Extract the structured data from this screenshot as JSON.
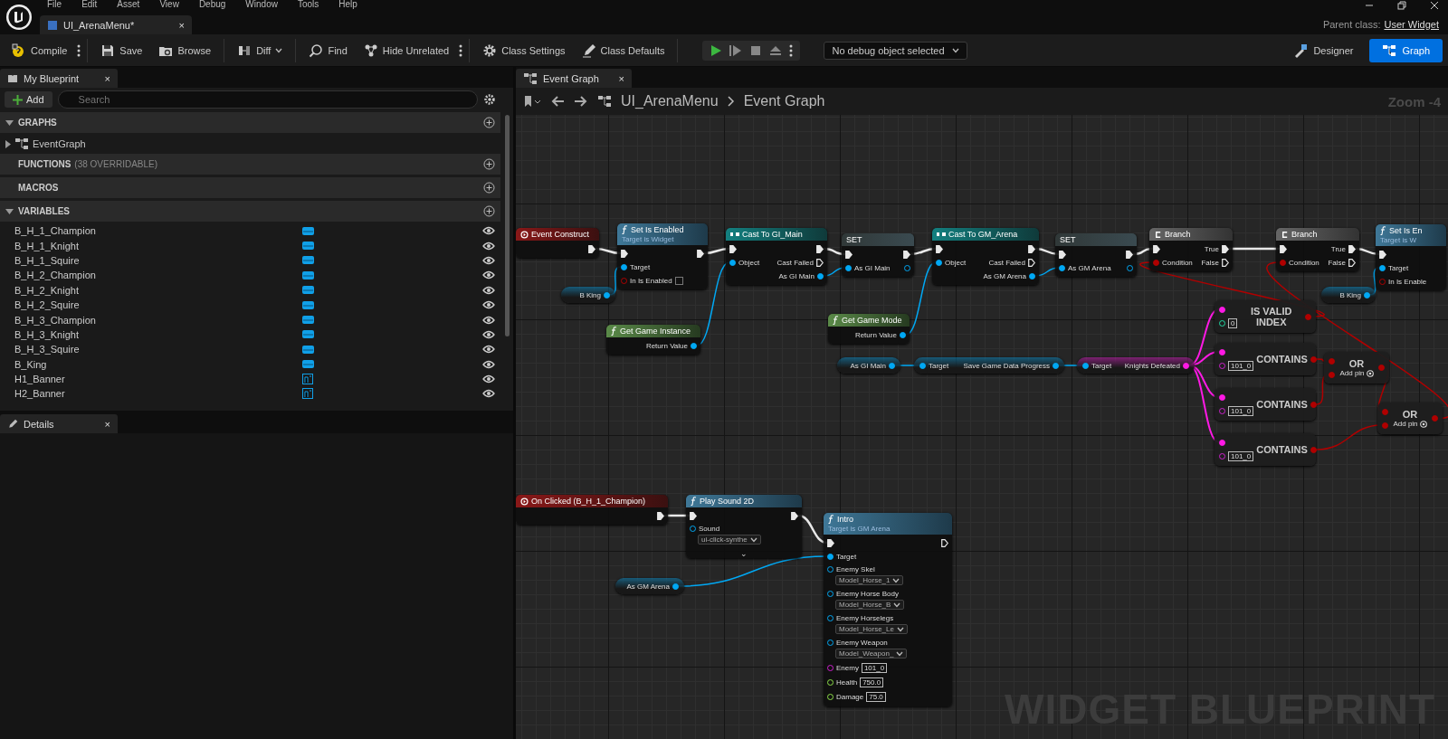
{
  "menu_bar": [
    "File",
    "Edit",
    "Asset",
    "View",
    "Debug",
    "Window",
    "Tools",
    "Help"
  ],
  "document_tab": {
    "title": "UI_ArenaMenu*",
    "close": "×"
  },
  "parent_class": {
    "label": "Parent class:",
    "value": "User Widget"
  },
  "toolbar": {
    "buttons": [
      {
        "kind": "compile",
        "label": "Compile",
        "menu": true
      },
      {
        "kind": "save",
        "label": "Save",
        "menu": false
      },
      {
        "kind": "browse",
        "label": "Browse",
        "menu": false
      },
      {
        "kind": "diff",
        "label": "Diff",
        "menu": false
      },
      {
        "kind": "find",
        "label": "Find",
        "menu": false
      },
      {
        "kind": "hide",
        "label": "Hide Unrelated",
        "menu": true
      },
      {
        "kind": "settings",
        "label": "Class Settings",
        "menu": false
      },
      {
        "kind": "defaults",
        "label": "Class Defaults",
        "menu": false
      }
    ],
    "debug_select": "No debug object selected",
    "modes": [
      {
        "kind": "designer",
        "label": "Designer",
        "selected": false
      },
      {
        "kind": "graph",
        "label": "Graph",
        "selected": true
      }
    ]
  },
  "my_blueprint": {
    "title": "My Blueprint",
    "close": "×",
    "add": "Add",
    "search_placeholder": "Search",
    "sections": [
      {
        "title": "GRAPHS",
        "expanded": true,
        "items": [
          {
            "label": "EventGraph"
          }
        ]
      },
      {
        "title": "FUNCTIONS",
        "note": "(38 OVERRIDABLE)",
        "expanded": false
      },
      {
        "title": "MACROS",
        "expanded": false
      },
      {
        "title": "VARIABLES",
        "expanded": true
      }
    ],
    "variables": [
      {
        "name": "B_H_1_Champion",
        "kind": "button"
      },
      {
        "name": "B_H_1_Knight",
        "kind": "button"
      },
      {
        "name": "B_H_1_Squire",
        "kind": "button"
      },
      {
        "name": "B_H_2_Champion",
        "kind": "button"
      },
      {
        "name": "B_H_2_Knight",
        "kind": "button"
      },
      {
        "name": "B_H_2_Squire",
        "kind": "button"
      },
      {
        "name": "B_H_3_Champion",
        "kind": "button"
      },
      {
        "name": "B_H_3_Knight",
        "kind": "button"
      },
      {
        "name": "B_H_3_Squire",
        "kind": "button"
      },
      {
        "name": "B_King",
        "kind": "button"
      },
      {
        "name": "H1_Banner",
        "kind": "image"
      },
      {
        "name": "H2_Banner",
        "kind": "image"
      }
    ]
  },
  "details": {
    "title": "Details",
    "close": "×"
  },
  "graph_tab": {
    "title": "Event Graph",
    "close": "×"
  },
  "breadcrumb": [
    "UI_ArenaMenu",
    "Event Graph"
  ],
  "zoom_label": "Zoom -4",
  "graph_watermark": "WIDGET BLUEPRINT",
  "nodes": [
    {
      "kind": "event",
      "title": "Event Construct",
      "outputs": [
        {
          "kind": "exec",
          "linked": true
        }
      ]
    },
    {
      "kind": "function",
      "title": "Set Is Enabled",
      "subtitle": "Target is Widget",
      "inputs": [
        {
          "kind": "exec",
          "linked": true
        },
        {
          "kind": "object",
          "label": "Target",
          "linked": true
        },
        {
          "kind": "bool",
          "label": "In Is Enabled",
          "linked": false,
          "checked": false
        }
      ],
      "outputs": [
        {
          "kind": "exec",
          "linked": true
        }
      ]
    },
    {
      "kind": "variable",
      "outputs": [
        {
          "kind": "object",
          "label": "B King",
          "linked": true
        }
      ]
    },
    {
      "kind": "pure",
      "title": "Get Game Instance",
      "outputs": [
        {
          "kind": "object",
          "label": "Return Value",
          "linked": true
        }
      ]
    },
    {
      "kind": "cast",
      "title": "Cast To GI_Main",
      "inputs": [
        {
          "kind": "exec",
          "linked": true
        },
        {
          "kind": "object",
          "label": "Object",
          "linked": true
        }
      ],
      "outputs": [
        {
          "kind": "exec",
          "linked": true
        },
        {
          "kind": "exec",
          "label": "Cast Failed",
          "linked": false
        },
        {
          "kind": "object",
          "label": "As GI Main",
          "linked": true
        }
      ]
    },
    {
      "kind": "set",
      "title": "SET",
      "inputs": [
        {
          "kind": "exec",
          "linked": true
        },
        {
          "kind": "object",
          "label": "As GI Main",
          "linked": true
        }
      ],
      "outputs": [
        {
          "kind": "exec",
          "linked": true
        },
        {
          "kind": "object",
          "linked": false
        }
      ]
    },
    {
      "kind": "pure",
      "title": "Get Game Mode",
      "outputs": [
        {
          "kind": "object",
          "label": "Return Value",
          "linked": true
        }
      ]
    },
    {
      "kind": "cast",
      "title": "Cast To GM_Arena",
      "inputs": [
        {
          "kind": "exec",
          "linked": true
        },
        {
          "kind": "object",
          "label": "Object",
          "linked": true
        }
      ],
      "outputs": [
        {
          "kind": "exec",
          "linked": true
        },
        {
          "kind": "exec",
          "label": "Cast Failed",
          "linked": false
        },
        {
          "kind": "object",
          "label": "As GM Arena",
          "linked": true
        }
      ]
    },
    {
      "kind": "set",
      "title": "SET",
      "inputs": [
        {
          "kind": "exec",
          "linked": true
        },
        {
          "kind": "object",
          "label": "As GM Arena",
          "linked": true
        }
      ],
      "outputs": [
        {
          "kind": "exec",
          "linked": true
        },
        {
          "kind": "object",
          "linked": false
        }
      ]
    },
    {
      "kind": "variable",
      "outputs": [
        {
          "kind": "object",
          "label": "As GI Main",
          "linked": true
        }
      ]
    },
    {
      "kind": "getter",
      "inputs": [
        {
          "kind": "object",
          "label": "Target",
          "linked": true
        }
      ],
      "outputs": [
        {
          "kind": "object",
          "label": "Save Game Data Progress",
          "linked": true
        }
      ]
    },
    {
      "kind": "getter",
      "inputs": [
        {
          "kind": "object",
          "label": "Target",
          "linked": true
        }
      ],
      "outputs": [
        {
          "kind": "array",
          "label": "Knights Defeated",
          "linked": true
        }
      ]
    },
    {
      "kind": "branch",
      "title": "Branch",
      "inputs": [
        {
          "kind": "exec",
          "linked": true
        },
        {
          "kind": "bool",
          "label": "Condition",
          "linked": true
        }
      ],
      "outputs": [
        {
          "kind": "exec",
          "label": "True",
          "linked": true
        },
        {
          "kind": "exec",
          "label": "False",
          "linked": false
        }
      ]
    },
    {
      "kind": "branch",
      "title": "Branch",
      "inputs": [
        {
          "kind": "exec",
          "linked": true
        },
        {
          "kind": "bool",
          "label": "Condition",
          "linked": true
        }
      ],
      "outputs": [
        {
          "kind": "exec",
          "label": "True",
          "linked": true
        },
        {
          "kind": "exec",
          "label": "False",
          "linked": false
        }
      ]
    },
    {
      "kind": "function",
      "title": "Set Is En",
      "subtitle": "Target is W",
      "inputs": [
        {
          "kind": "exec",
          "linked": true
        },
        {
          "kind": "object",
          "label": "Target",
          "linked": true
        },
        {
          "kind": "bool",
          "label": "In Is Enable",
          "linked": false
        }
      ]
    },
    {
      "kind": "variable",
      "outputs": [
        {
          "kind": "object",
          "label": "B King",
          "linked": true
        }
      ]
    },
    {
      "kind": "compact",
      "title": "IS VALID INDEX",
      "inputs": [
        {
          "kind": "array",
          "linked": true
        },
        {
          "kind": "int",
          "value": "0",
          "linked": false
        }
      ],
      "outputs": [
        {
          "kind": "bool",
          "linked": true
        }
      ]
    },
    {
      "kind": "compact",
      "title": "CONTAINS",
      "inputs": [
        {
          "kind": "array",
          "linked": true
        },
        {
          "kind": "struct",
          "value": "101_0",
          "linked": false
        }
      ],
      "outputs": [
        {
          "kind": "bool",
          "linked": true
        }
      ]
    },
    {
      "kind": "compact",
      "title": "CONTAINS",
      "inputs": [
        {
          "kind": "array",
          "linked": true
        },
        {
          "kind": "struct",
          "value": "101_0",
          "linked": false
        }
      ],
      "outputs": [
        {
          "kind": "bool",
          "linked": true
        }
      ]
    },
    {
      "kind": "compact",
      "title": "CONTAINS",
      "inputs": [
        {
          "kind": "array",
          "linked": true
        },
        {
          "kind": "struct",
          "value": "101_0",
          "linked": false
        }
      ],
      "outputs": [
        {
          "kind": "bool",
          "linked": true
        }
      ]
    },
    {
      "kind": "compact",
      "title": "OR",
      "footer": "Add pin",
      "inputs": [
        {
          "kind": "bool",
          "linked": true
        },
        {
          "kind": "bool",
          "linked": true
        }
      ],
      "outputs": [
        {
          "kind": "bool",
          "linked": true
        }
      ]
    },
    {
      "kind": "compact",
      "title": "OR",
      "footer": "Add pin",
      "inputs": [
        {
          "kind": "bool",
          "linked": true
        },
        {
          "kind": "bool",
          "linked": true
        }
      ],
      "outputs": [
        {
          "kind": "bool",
          "linked": true
        }
      ]
    },
    {
      "kind": "event",
      "title": "On Clicked (B_H_1_Champion)",
      "outputs": [
        {
          "kind": "exec",
          "linked": true
        }
      ]
    },
    {
      "kind": "function",
      "title": "Play Sound 2D",
      "expander": "⌄",
      "inputs": [
        {
          "kind": "exec",
          "linked": true
        },
        {
          "kind": "object",
          "label": "Sound",
          "value": "ui-click-synthe",
          "linked": false
        }
      ],
      "outputs": [
        {
          "kind": "exec",
          "linked": true
        }
      ]
    },
    {
      "kind": "variable",
      "outputs": [
        {
          "kind": "object",
          "label": "As GM Arena",
          "linked": true
        }
      ]
    },
    {
      "kind": "function",
      "title": "Intro",
      "subtitle": "Target is GM Arena",
      "inputs": [
        {
          "kind": "exec",
          "linked": true
        },
        {
          "kind": "object",
          "label": "Target",
          "linked": true
        },
        {
          "kind": "object",
          "label": "Enemy Skel",
          "value": "Model_Horse_1",
          "linked": false
        },
        {
          "kind": "object",
          "label": "Enemy Horse Body",
          "value": "Model_Horse_B",
          "linked": false
        },
        {
          "kind": "object",
          "label": "Enemy Horselegs",
          "value": "Model_Horse_Le",
          "linked": false
        },
        {
          "kind": "object",
          "label": "Enemy Weapon",
          "value": "Model_Weapon_",
          "linked": false
        },
        {
          "kind": "struct",
          "label": "Enemy",
          "value": "101_0",
          "linked": false
        },
        {
          "kind": "float",
          "label": "Health",
          "value": "750.0",
          "linked": false
        },
        {
          "kind": "float",
          "label": "Damage",
          "value": "75.0",
          "linked": false
        }
      ],
      "outputs": [
        {
          "kind": "exec",
          "linked": false
        }
      ]
    }
  ]
}
